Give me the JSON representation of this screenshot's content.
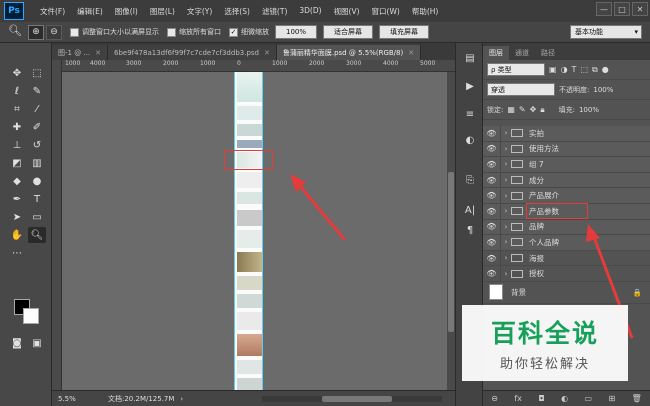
{
  "app": {
    "logo": "Ps"
  },
  "menu": [
    "文件(F)",
    "编辑(E)",
    "图像(I)",
    "图层(L)",
    "文字(Y)",
    "选择(S)",
    "滤镜(T)",
    "3D(D)",
    "视图(V)",
    "窗口(W)",
    "帮助(H)"
  ],
  "window_buttons": {
    "minimize": "—",
    "maximize": "□",
    "close": "✕"
  },
  "options": {
    "resize_windows": "调整窗口大小以满屏显示",
    "zoom_all": "缩放所有窗口",
    "scrubby_zoom": "细微缩放",
    "zoom_value": "100%",
    "fit_screen": "适合屏幕",
    "fill_screen": "填充屏幕",
    "workspace": "基本功能"
  },
  "tabs": [
    {
      "label": "图-1 @ ...",
      "active": false
    },
    {
      "label": "6be9f478a13df6f99f7c7cde7cf3ddb3.psd",
      "active": false
    },
    {
      "label": "鲁蒲丽精华面膜.psd @ 5.5%(RGB/8)",
      "active": true
    }
  ],
  "ruler": [
    "1000",
    "4000",
    "3000",
    "2000",
    "1000",
    "0",
    "1000",
    "2000",
    "3000",
    "4000",
    "5000"
  ],
  "status": {
    "zoom": "5.5%",
    "doc": "文档:20.2M/125.7M"
  },
  "panel": {
    "tabs": [
      "图层",
      "通道",
      "路径"
    ],
    "kind": "ρ 类型",
    "blend_mode": "穿透",
    "opacity_label": "不透明度:",
    "opacity": "100%",
    "lock_label": "锁定:",
    "fill_label": "填充:",
    "fill": "100%"
  },
  "layers": [
    {
      "name": "实拍",
      "visible": true
    },
    {
      "name": "使用方法",
      "visible": true
    },
    {
      "name": "组 7",
      "visible": true
    },
    {
      "name": "成分",
      "visible": true
    },
    {
      "name": "产品展介",
      "visible": true
    },
    {
      "name": "产品参数",
      "visible": true
    },
    {
      "name": "品牌",
      "visible": true
    },
    {
      "name": "个人品牌",
      "visible": true
    },
    {
      "name": "海报",
      "visible": true
    },
    {
      "name": "授权",
      "visible": true
    }
  ],
  "background_layer": {
    "name": "背景",
    "lock": "🔒"
  },
  "watermark": {
    "title": "百科全说",
    "subtitle": "助你轻松解决"
  },
  "colors": {
    "highlight": "#e53b3b",
    "watermark_green": "#16a05a"
  }
}
